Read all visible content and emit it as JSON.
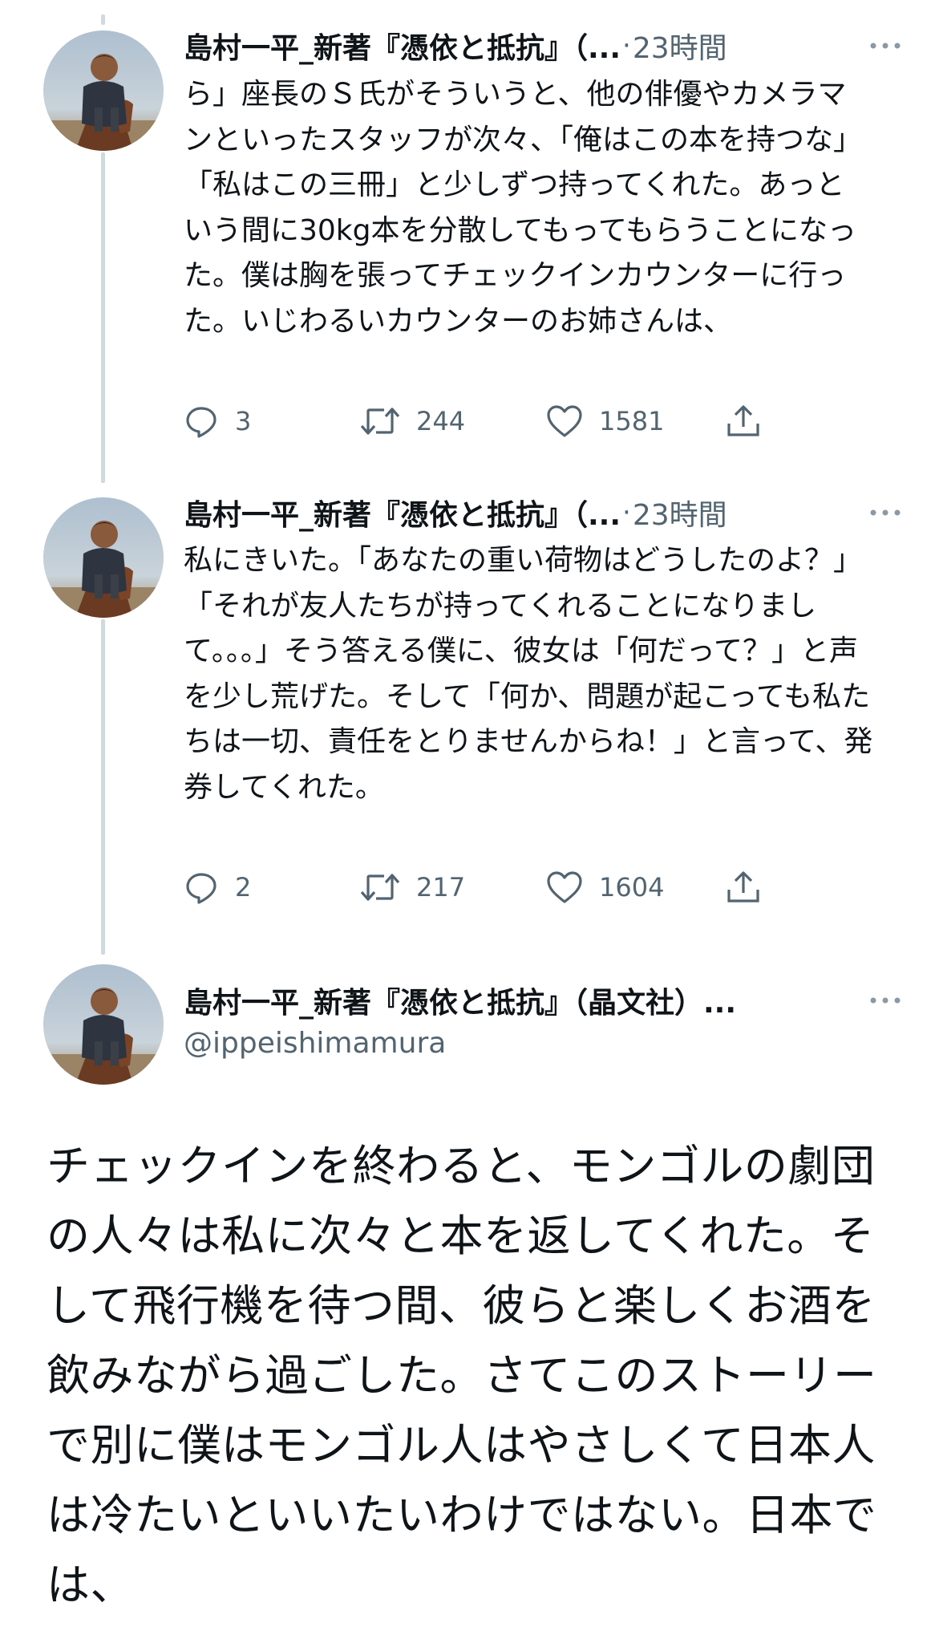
{
  "thread": [
    {
      "author_name": "島村一平_新著『憑依と抵抗』（...",
      "dot": "·",
      "time": "23時間",
      "text": "ら」座長のＳ氏がそういうと、他の俳優やカメラマンといったスタッフが次々、「俺はこの本を持つな」「私はこの三冊」と少しずつ持ってくれた。あっという間に30kg本を分散してもってもらうことになった。僕は胸を張ってチェックインカウンターに行った。いじわるいカウンターのお姉さんは、",
      "replies": "3",
      "retweets": "244",
      "likes": "1581"
    },
    {
      "author_name": "島村一平_新著『憑依と抵抗』（...",
      "dot": "·",
      "time": "23時間",
      "text": "私にきいた。「あなたの重い荷物はどうしたのよ？」「それが友人たちが持ってくれることになりまして。。。」そう答える僕に、彼女は「何だって？」と声を少し荒げた。そして「何か、問題が起こっても私たちは一切、責任をとりませんからね！」と言って、発券してくれた。",
      "replies": "2",
      "retweets": "217",
      "likes": "1604"
    }
  ],
  "main_tweet": {
    "author_name": "島村一平_新著『憑依と抵抗』（晶文社）...",
    "handle": "@ippeishimamura",
    "text": "チェックインを終わると、モンゴルの劇団の人々は私に次々と本を返してくれた。そして飛行機を待つ間、彼らと楽しくお酒を飲みながら過ごした。さてこのストーリーで別に僕はモンゴル人はやさしくて日本人は冷たいといいたいわけではない。日本では、"
  },
  "icons": {
    "more": "more-horizontal-icon",
    "reply": "reply-icon",
    "retweet": "retweet-icon",
    "like": "heart-icon",
    "share": "share-icon"
  },
  "colors": {
    "text": "#0f1419",
    "secondary": "#536471",
    "thread_line": "#cfd9de",
    "background": "#ffffff"
  }
}
